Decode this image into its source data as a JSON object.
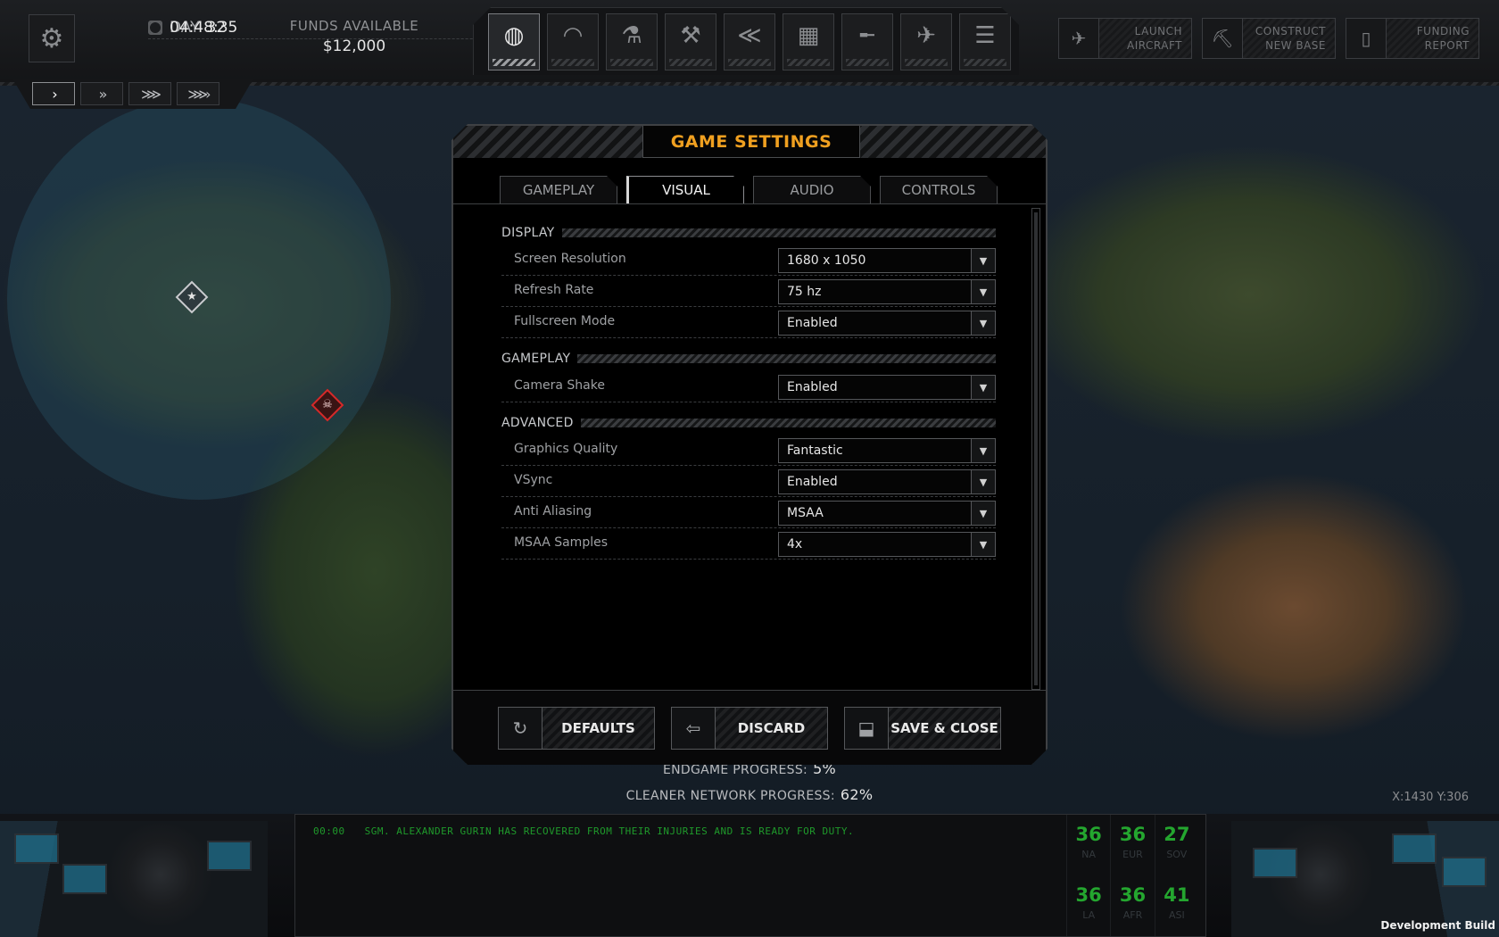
{
  "hud": {
    "day_label": "DAY",
    "day_value": "32",
    "time": "04:48:35",
    "funds_label": "FUNDS AVAILABLE",
    "funds_value": "$12,000"
  },
  "nav_icons": [
    "globe-icon",
    "hangar-icon",
    "research-icon",
    "engineering-icon",
    "soldiers-icon",
    "stores-icon",
    "weapons-icon",
    "aircraft-icon",
    "archives-icon"
  ],
  "actions": {
    "launch": "LAUNCH\nAIRCRAFT",
    "construct": "CONSTRUCT\nNEW BASE",
    "funding": "FUNDING\nREPORT"
  },
  "speed": [
    "›",
    "»",
    "⋙",
    "⋙›"
  ],
  "dialog": {
    "title": "GAME SETTINGS",
    "tabs": [
      "GAMEPLAY",
      "VISUAL",
      "AUDIO",
      "CONTROLS"
    ],
    "active_tab": "VISUAL",
    "sections": {
      "display": "DISPLAY",
      "gameplay": "GAMEPLAY",
      "advanced": "ADVANCED"
    },
    "settings": {
      "resolution": {
        "label": "Screen Resolution",
        "value": "1680 x 1050"
      },
      "refresh": {
        "label": "Refresh Rate",
        "value": "75 hz"
      },
      "fullscreen": {
        "label": "Fullscreen Mode",
        "value": "Enabled"
      },
      "shake": {
        "label": "Camera Shake",
        "value": "Enabled"
      },
      "quality": {
        "label": "Graphics Quality",
        "value": "Fantastic"
      },
      "vsync": {
        "label": "VSync",
        "value": "Enabled"
      },
      "aa": {
        "label": "Anti Aliasing",
        "value": "MSAA"
      },
      "msaa": {
        "label": "MSAA Samples",
        "value": "4x"
      }
    },
    "buttons": {
      "defaults": "DEFAULTS",
      "discard": "DISCARD",
      "save": "SAVE & CLOSE"
    }
  },
  "progress": {
    "endgame_label": "ENDGAME PROGRESS:",
    "endgame_value": "5%",
    "cleaner_label": "CLEANER NETWORK PROGRESS:",
    "cleaner_value": "62%"
  },
  "cursor_coords": "X:1430  Y:306",
  "console": {
    "time": "00:00",
    "message": "SGM. ALEXANDER GURIN HAS RECOVERED FROM THEIR INJURIES AND IS READY FOR DUTY."
  },
  "regions": [
    {
      "value": "36",
      "name": "NA"
    },
    {
      "value": "36",
      "name": "EUR"
    },
    {
      "value": "27",
      "name": "SOV"
    },
    {
      "value": "36",
      "name": "LA"
    },
    {
      "value": "36",
      "name": "AFR"
    },
    {
      "value": "41",
      "name": "ASI"
    }
  ],
  "dev_build": "Development Build",
  "colors": {
    "accent": "#f0a020",
    "console_green": "#1f9a2b"
  }
}
